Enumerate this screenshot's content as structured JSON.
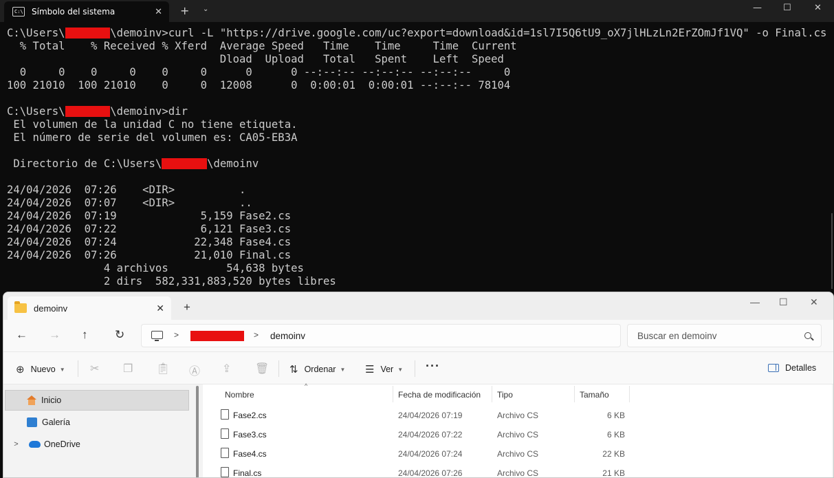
{
  "terminal": {
    "tab_title": "Símbolo del sistema",
    "icon": "cmd-icon",
    "lines": [
      {
        "pre": "C:\\Users\\",
        "redact_chars": 7,
        "post": "\\demoinv>curl -L \"https://drive.google.com/uc?export=download&id=1sl7I5Q6tU9_oX7jlHLzLn2ErZOmJf1VQ\" -o Final.cs"
      },
      {
        "text": "  % Total    % Received % Xferd  Average Speed   Time    Time     Time  Current"
      },
      {
        "text": "                                 Dload  Upload   Total   Spent    Left  Speed"
      },
      {
        "text": "  0     0    0     0    0     0      0      0 --:--:-- --:--:-- --:--:--     0"
      },
      {
        "text": "100 21010  100 21010    0     0  12008      0  0:00:01  0:00:01 --:--:-- 78104"
      },
      {
        "text": ""
      },
      {
        "pre": "C:\\Users\\",
        "redact_chars": 7,
        "post": "\\demoinv>dir"
      },
      {
        "text": " El volumen de la unidad C no tiene etiqueta."
      },
      {
        "text": " El número de serie del volumen es: CA05-EB3A"
      },
      {
        "text": ""
      },
      {
        "pre": " Directorio de C:\\Users\\",
        "redact_chars": 7,
        "post": "\\demoinv"
      },
      {
        "text": ""
      },
      {
        "text": "24/04/2026  07:26    <DIR>          ."
      },
      {
        "text": "24/04/2026  07:07    <DIR>          .."
      },
      {
        "text": "24/04/2026  07:19             5,159 Fase2.cs"
      },
      {
        "text": "24/04/2026  07:22             6,121 Fase3.cs"
      },
      {
        "text": "24/04/2026  07:24            22,348 Fase4.cs"
      },
      {
        "text": "24/04/2026  07:26            21,010 Final.cs"
      },
      {
        "text": "               4 archivos         54,638 bytes"
      },
      {
        "text": "               2 dirs  582,331,883,520 bytes libres"
      }
    ]
  },
  "explorer": {
    "tab_title": "demoinv",
    "address": {
      "current": "demoinv"
    },
    "search_placeholder": "Buscar en demoinv",
    "toolbar": {
      "nuevo": "Nuevo",
      "ordenar": "Ordenar",
      "ver": "Ver",
      "more": "···",
      "detalles": "Detalles"
    },
    "nav": [
      {
        "label": "Inicio",
        "icon": "home-icon",
        "selected": true
      },
      {
        "label": "Galería",
        "icon": "gallery-icon",
        "selected": false
      },
      {
        "label": "OneDrive",
        "icon": "onedrive-icon",
        "selected": false
      }
    ],
    "columns": [
      "Nombre",
      "Fecha de modificación",
      "Tipo",
      "Tamaño"
    ],
    "files": [
      {
        "name": "Fase2.cs",
        "date": "24/04/2026 07:19",
        "type": "Archivo CS",
        "size": "6 KB"
      },
      {
        "name": "Fase3.cs",
        "date": "24/04/2026 07:22",
        "type": "Archivo CS",
        "size": "6 KB"
      },
      {
        "name": "Fase4.cs",
        "date": "24/04/2026 07:24",
        "type": "Archivo CS",
        "size": "22 KB"
      },
      {
        "name": "Final.cs",
        "date": "24/04/2026 07:26",
        "type": "Archivo CS",
        "size": "21 KB"
      }
    ]
  },
  "colors": {
    "terminal_bg": "#0c0c0c",
    "terminal_text": "#cccccc",
    "redaction": "#e81010",
    "explorer_bg": "#f3f3f3"
  }
}
